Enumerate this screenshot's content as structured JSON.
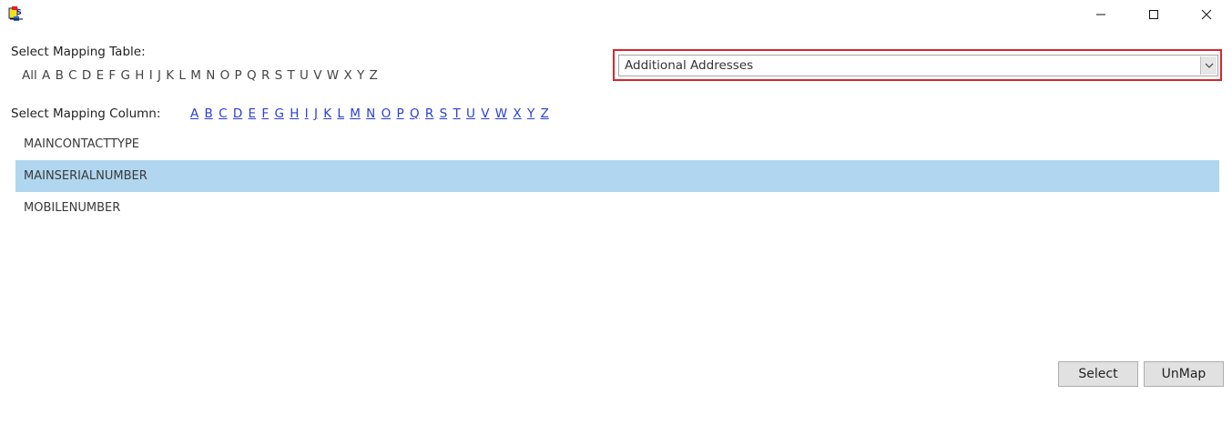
{
  "window": {
    "app_icon": "mapping-app-icon",
    "minimize_icon": "minimize-icon",
    "maximize_icon": "maximize-icon",
    "close_icon": "close-icon"
  },
  "mapping_table": {
    "label": "Select Mapping Table:",
    "letters": [
      "All",
      "A",
      "B",
      "C",
      "D",
      "E",
      "F",
      "G",
      "H",
      "I",
      "J",
      "K",
      "L",
      "M",
      "N",
      "O",
      "P",
      "Q",
      "R",
      "S",
      "T",
      "U",
      "V",
      "W",
      "X",
      "Y",
      "Z"
    ],
    "selected_value": "Additional Addresses",
    "dropdown_icon": "chevron-down-icon",
    "highlight_color": "#d9262d"
  },
  "mapping_column": {
    "label": "Select Mapping Column:",
    "letters": [
      "A",
      "B",
      "C",
      "D",
      "E",
      "F",
      "G",
      "H",
      "I",
      "J",
      "K",
      "L",
      "M",
      "N",
      "O",
      "P",
      "Q",
      "R",
      "S",
      "T",
      "U",
      "V",
      "W",
      "X",
      "Y",
      "Z"
    ],
    "link_color": "#2a3fd4",
    "items": [
      {
        "label": "MAINCONTACTTYPE",
        "selected": false
      },
      {
        "label": "MAINSERIALNUMBER",
        "selected": true
      },
      {
        "label": "MOBILENUMBER",
        "selected": false
      }
    ],
    "selection_color": "#b1d6ef"
  },
  "buttons": {
    "select_label": "Select",
    "unmap_label": "UnMap"
  }
}
